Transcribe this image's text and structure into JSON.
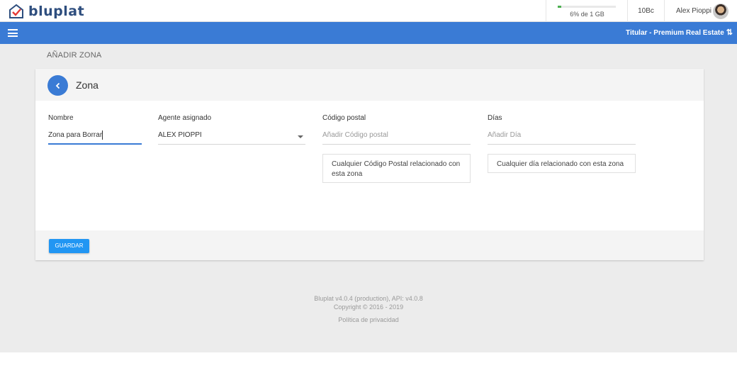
{
  "header": {
    "logo_text": "bluplat",
    "storage": {
      "label": "6% de 1 GB",
      "percent": 6,
      "color": "#4caf50"
    },
    "credits": "10Bc",
    "user_name": "Alex Pioppi"
  },
  "navbar": {
    "account": "Titular - Premium Real Estate",
    "account_icon": "swap-arrows-icon",
    "color": "#3a7bd5"
  },
  "page": {
    "title": "AÑADIR ZONA"
  },
  "card": {
    "title": "Zona",
    "fields": {
      "nombre": {
        "label": "Nombre",
        "value": "Zona para Borrar"
      },
      "agente": {
        "label": "Agente asignado",
        "value": "ALEX PIOPPI"
      },
      "codigo": {
        "label": "Código postal",
        "placeholder": "Añadir Código postal",
        "hint": "Cualquier Código Postal relacionado con esta zona"
      },
      "dias": {
        "label": "Días",
        "placeholder": "Añadir Día",
        "hint": "Cualquier día relacionado con esta zona"
      }
    },
    "save_label": "GUARDAR"
  },
  "footer": {
    "version": "Bluplat v4.0.4 (production), API: v4.0.8",
    "copyright": "Copyright © 2016 - 2019",
    "privacy": "Política de privacidad"
  }
}
